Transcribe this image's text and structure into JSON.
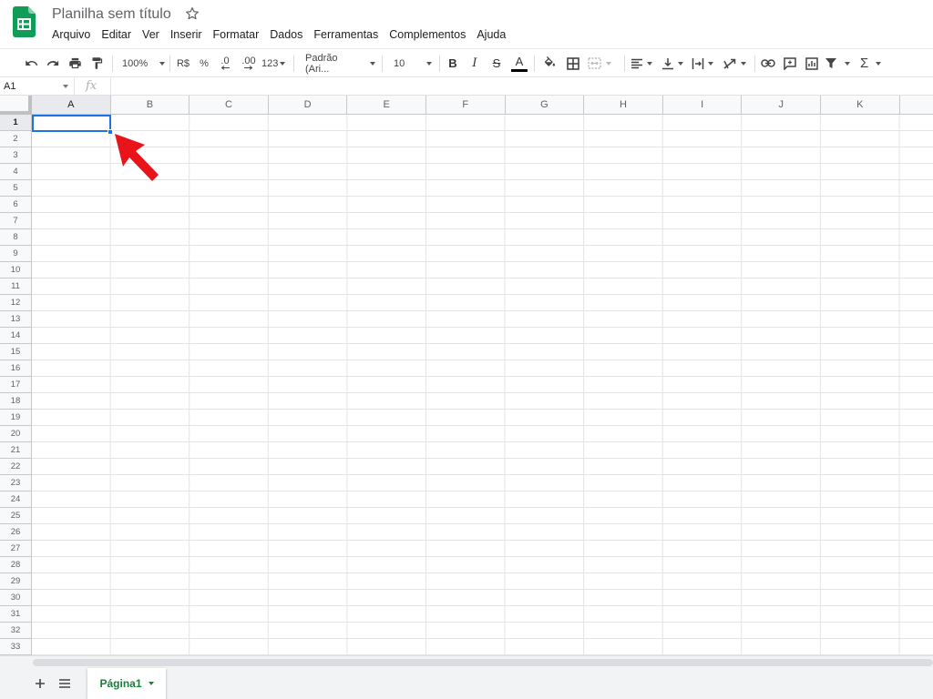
{
  "app": {
    "title": "Planilha sem título"
  },
  "menu": [
    "Arquivo",
    "Editar",
    "Ver",
    "Inserir",
    "Formatar",
    "Dados",
    "Ferramentas",
    "Complementos",
    "Ajuda"
  ],
  "toolbar": {
    "zoom": "100%",
    "currency": "R$",
    "percent": "%",
    "decrease_decimals": ".0",
    "increase_decimals": ".00",
    "more_formats": "123",
    "font": "Padrão (Ari...",
    "font_size": "10",
    "bold": "B",
    "italic": "I",
    "strikethrough": "S",
    "text_color": "A",
    "sum": "Σ",
    "icons": [
      "undo-icon",
      "redo-icon",
      "print-icon",
      "paint-format-icon",
      "fill-color-icon",
      "borders-icon",
      "merge-cells-icon",
      "horizontal-align-icon",
      "vertical-align-icon",
      "text-wrap-icon",
      "text-rotation-icon",
      "link-icon",
      "comment-icon",
      "chart-icon",
      "filter-icon",
      "functions-icon"
    ]
  },
  "formula_bar": {
    "name_box": "A1",
    "fx": "fx",
    "value": ""
  },
  "grid": {
    "columns": [
      "A",
      "B",
      "C",
      "D",
      "E",
      "F",
      "G",
      "H",
      "I",
      "J",
      "K"
    ],
    "rows": [
      "1",
      "2",
      "3",
      "4",
      "5",
      "6",
      "7",
      "8",
      "9",
      "10",
      "11",
      "12",
      "13",
      "14",
      "15",
      "16",
      "17",
      "18",
      "19",
      "20",
      "21",
      "22",
      "23",
      "24",
      "25",
      "26",
      "27",
      "28",
      "29",
      "30",
      "31",
      "32",
      "33"
    ],
    "selected": "A1"
  },
  "sheets": {
    "tabs": [
      "Página1"
    ]
  },
  "colors": {
    "accent": "#1a73e8",
    "sheet_tab": "#188038",
    "brand": "#0f9d58",
    "annotation_arrow": "#e8141a"
  }
}
